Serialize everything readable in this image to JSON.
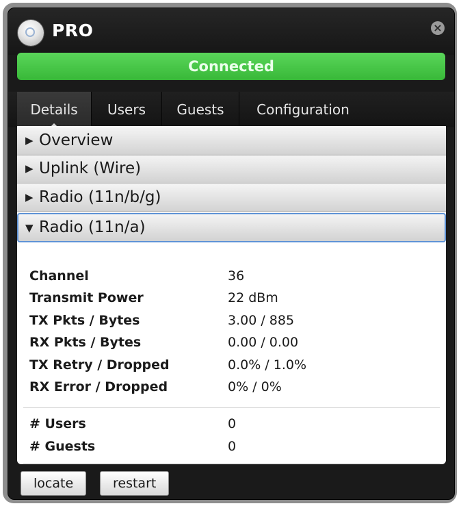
{
  "window": {
    "title": "PRO",
    "logo_icon": "ubiquiti-logo-icon",
    "close_icon": "close-icon"
  },
  "status": {
    "text": "Connected",
    "color": "#44c444"
  },
  "tabs": [
    {
      "label": "Details",
      "active": true
    },
    {
      "label": "Users",
      "active": false
    },
    {
      "label": "Guests",
      "active": false
    },
    {
      "label": "Configuration",
      "active": false
    }
  ],
  "sections": [
    {
      "label": "Overview",
      "expanded": false
    },
    {
      "label": "Uplink (Wire)",
      "expanded": false
    },
    {
      "label": "Radio (11n/b/g)",
      "expanded": false
    },
    {
      "label": "Radio (11n/a)",
      "expanded": true
    }
  ],
  "radio_details": [
    {
      "key": "Channel",
      "value": "36"
    },
    {
      "key": "Transmit Power",
      "value": "22 dBm"
    },
    {
      "key": "TX Pkts / Bytes",
      "value": "3.00 / 885"
    },
    {
      "key": "RX Pkts / Bytes",
      "value": "0.00 / 0.00"
    },
    {
      "key": "TX Retry / Dropped",
      "value": "0.0% / 1.0%"
    },
    {
      "key": "RX Error / Dropped",
      "value": "0% / 0%"
    }
  ],
  "counts": [
    {
      "key": "# Users",
      "value": "0"
    },
    {
      "key": "# Guests",
      "value": "0"
    }
  ],
  "footer": {
    "locate_label": "locate",
    "restart_label": "restart"
  }
}
